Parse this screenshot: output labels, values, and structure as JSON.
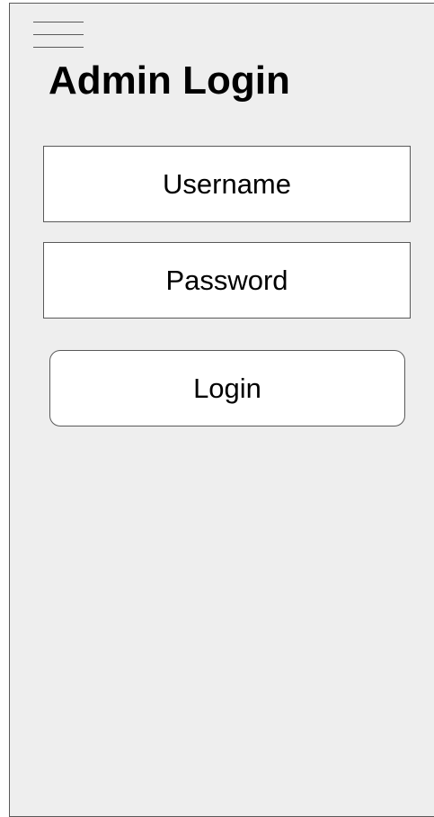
{
  "header": {
    "menu_icon": "hamburger-menu-icon",
    "title": "Admin Login"
  },
  "form": {
    "username_placeholder": "Username",
    "password_placeholder": "Password",
    "login_label": "Login"
  },
  "colors": {
    "background": "#eeeeee",
    "border": "#595959",
    "field_background": "#ffffff",
    "text": "#000000"
  }
}
